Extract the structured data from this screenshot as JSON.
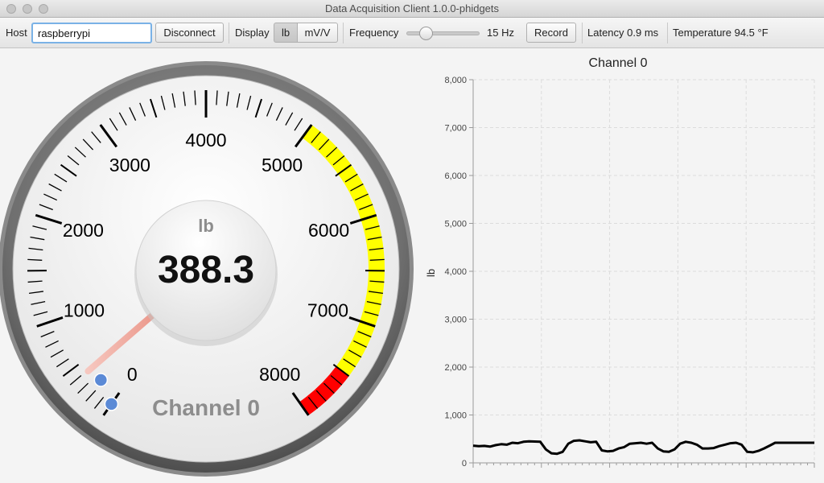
{
  "window": {
    "title": "Data Acquisition Client 1.0.0-phidgets"
  },
  "toolbar": {
    "host_label": "Host",
    "host_value": "raspberrypi",
    "disconnect_label": "Disconnect",
    "display_label": "Display",
    "display_options": [
      "lb",
      "mV/V"
    ],
    "display_selected": "lb",
    "frequency_label": "Frequency",
    "frequency_value": "15 Hz",
    "frequency_hz": 15,
    "record_label": "Record",
    "latency_text": "Latency 0.9 ms",
    "temperature_text": "Temperature 94.5 °F"
  },
  "gauge": {
    "unit": "lb",
    "value_text": "388.3",
    "value": 388.3,
    "title": "Channel 0",
    "min": 0,
    "max": 8000,
    "major_labels": [
      "0",
      "1000",
      "2000",
      "3000",
      "4000",
      "5000",
      "6000",
      "7000",
      "8000"
    ],
    "yellow_range": [
      5000,
      7500
    ],
    "red_range": [
      7500,
      8000
    ],
    "colors": {
      "yellow": "#ffff00",
      "red": "#ff0000",
      "needle": "#f3a79b",
      "marker": "#5b8ad6"
    }
  },
  "chart_data": {
    "type": "line",
    "title": "Channel 0",
    "xlabel": "",
    "ylabel": "lb",
    "ylim": [
      0,
      8000
    ],
    "yticks": [
      "0",
      "1,000",
      "2,000",
      "3,000",
      "4,000",
      "5,000",
      "6,000",
      "7,000",
      "8,000"
    ],
    "grid": true,
    "legend": "none",
    "series": [
      {
        "values": [
          360,
          350,
          355,
          340,
          370,
          390,
          380,
          420,
          410,
          440,
          450,
          445,
          440,
          280,
          200,
          190,
          230,
          400,
          460,
          470,
          450,
          430,
          440,
          260,
          240,
          250,
          300,
          330,
          400,
          410,
          420,
          400,
          420,
          300,
          240,
          230,
          280,
          400,
          440,
          420,
          380,
          300,
          300,
          310,
          350,
          380,
          410,
          420,
          380,
          230,
          220,
          250,
          300,
          360,
          420,
          420,
          420,
          420,
          420,
          420,
          420,
          420
        ]
      }
    ]
  }
}
